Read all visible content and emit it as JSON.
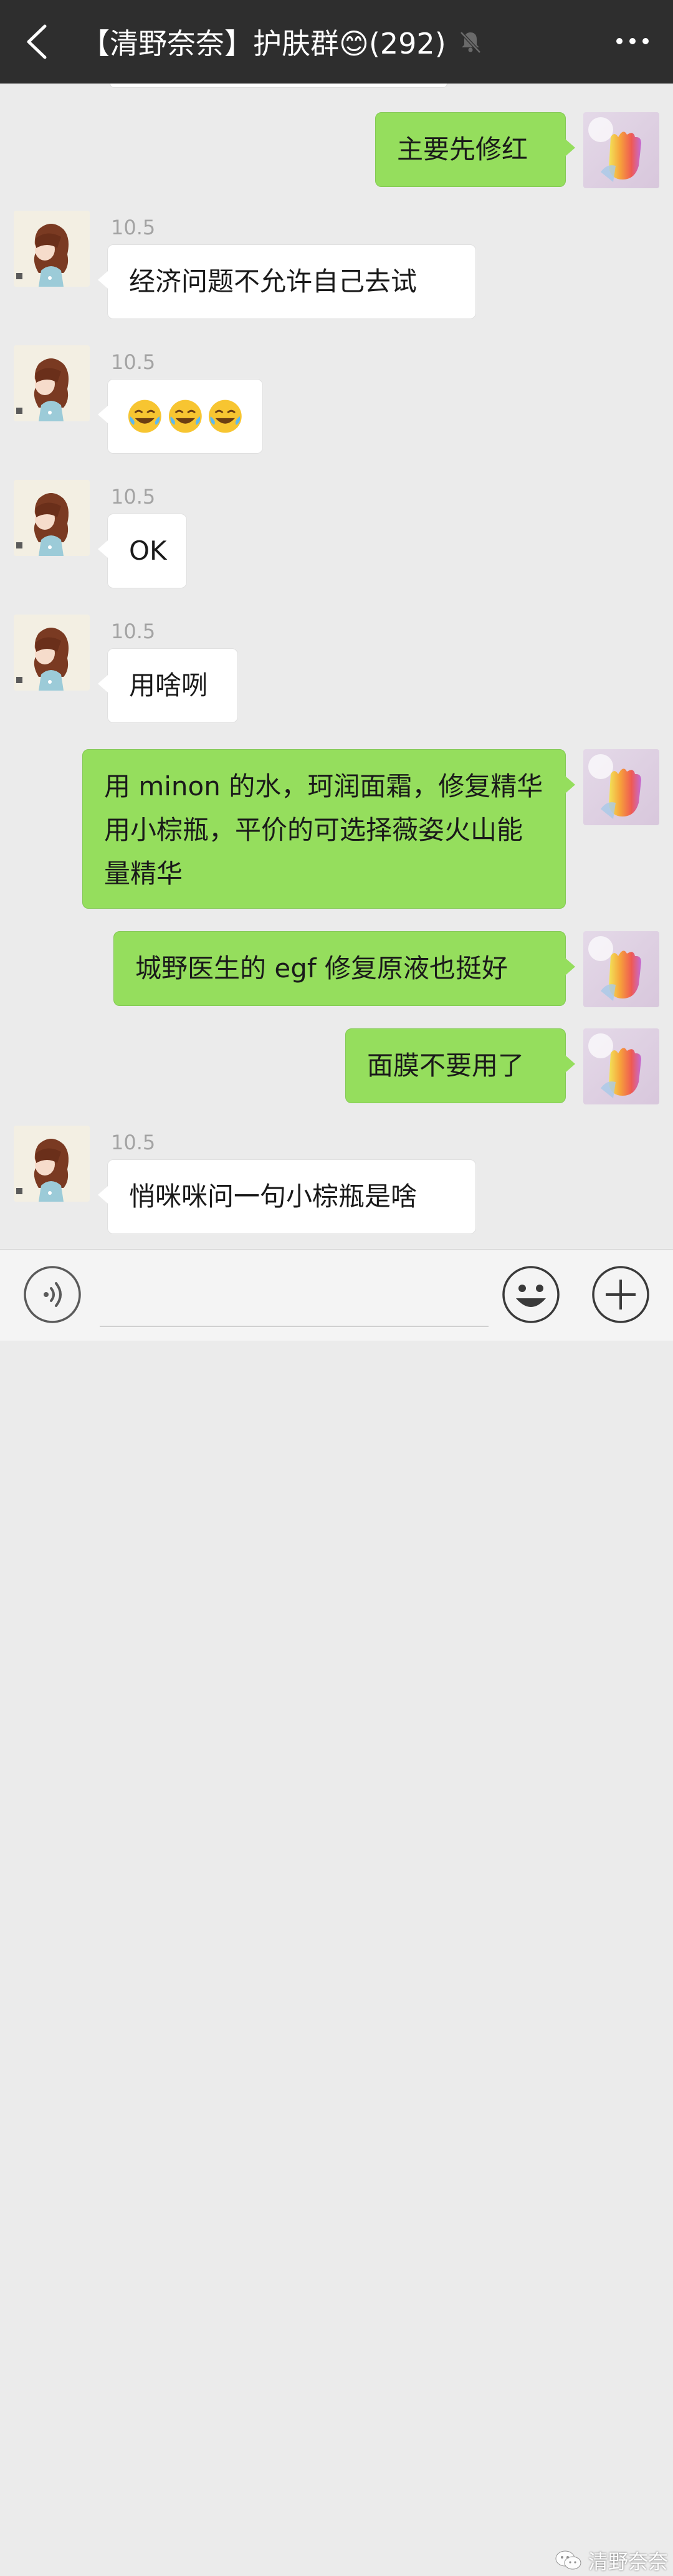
{
  "header": {
    "title": "【清野奈奈】护肤群😊(292)"
  },
  "messages": [
    {
      "side": "right",
      "text": "主要先修红"
    },
    {
      "side": "left",
      "timestamp": "10.5",
      "text": "经济问题不允许自己去试"
    },
    {
      "side": "left",
      "timestamp": "10.5",
      "text": "😂😂😂"
    },
    {
      "side": "left",
      "timestamp": "10.5",
      "text": "OK"
    },
    {
      "side": "left",
      "timestamp": "10.5",
      "text": "用啥咧"
    },
    {
      "side": "right",
      "text": "用 minon 的水，珂润面霜，修复精华用小棕瓶，平价的可选择薇姿火山能量精华"
    },
    {
      "side": "right",
      "text": "城野医生的 egf 修复原液也挺好"
    },
    {
      "side": "right",
      "text": "面膜不要用了"
    },
    {
      "side": "left",
      "timestamp": "10.5",
      "text": "悄咪咪问一句小棕瓶是啥"
    }
  ],
  "input": {
    "value": ""
  },
  "watermark": {
    "text": "清野奈奈"
  },
  "colors": {
    "header_bg": "#2e2e2e",
    "chat_bg": "#ebebeb",
    "bubble_green": "#95de5d",
    "bubble_white": "#ffffff"
  }
}
